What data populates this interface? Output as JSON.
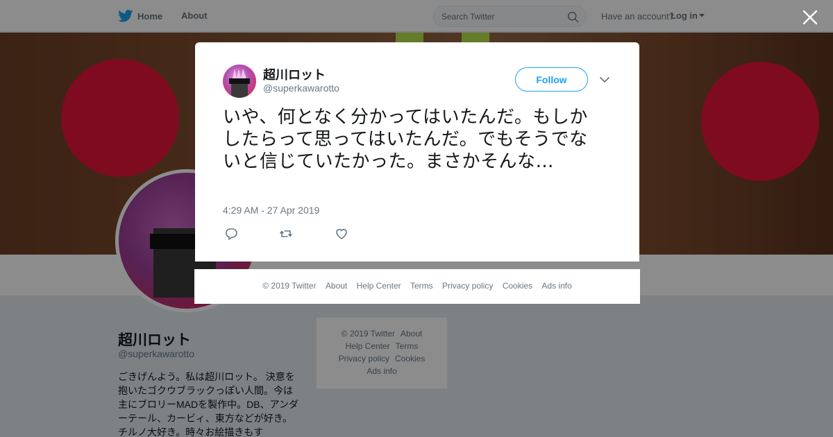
{
  "nav": {
    "home_label": "Home",
    "about_label": "About",
    "search_placeholder": "Search Twitter",
    "have_account": "Have an account?",
    "login_label": "Log in"
  },
  "colors": {
    "brand": "#1da1f2",
    "banner_accent": "#e8153b",
    "secondary_text": "#657786"
  },
  "profile": {
    "name": "超川ロット",
    "handle": "@superkawarotto",
    "bio": "ごきげんよう。私は超川ロット。 決意を抱いたゴクウブラックっぽい人間。今は主にブロリーMADを製作中。DB、アンダーテール、カービィ、東方などが好き。チルノ大好き。時々お絵描きもす"
  },
  "side_footer": {
    "items": [
      "© 2019 Twitter",
      "About",
      "Help Center",
      "Terms",
      "Privacy policy",
      "Cookies",
      "Ads info"
    ]
  },
  "tweet": {
    "author_name": "超川ロット",
    "author_handle": "@superkawarotto",
    "follow_label": "Follow",
    "text": "いや、何となく分かってはいたんだ。もしかしたらって思ってはいたんだ。でもそうでないと信じていたかった。まさかそんな…",
    "timestamp": "4:29 AM - 27 Apr 2019"
  },
  "modal_footer": {
    "items": [
      "© 2019 Twitter",
      "About",
      "Help Center",
      "Terms",
      "Privacy policy",
      "Cookies",
      "Ads info"
    ]
  },
  "icons": {
    "brand": "twitter-bird-icon",
    "search": "search-icon",
    "close": "close-icon",
    "reply": "reply-icon",
    "retweet": "retweet-icon",
    "like": "heart-icon",
    "more": "chevron-down-icon"
  }
}
